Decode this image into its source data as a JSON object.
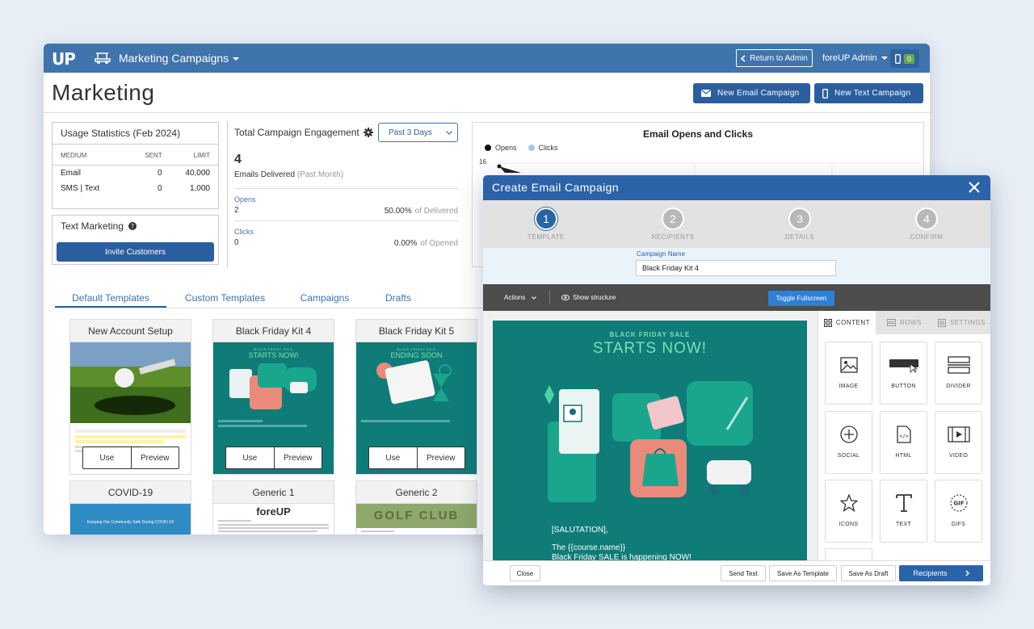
{
  "topbar": {
    "logo": "UP",
    "app_title": "Marketing Campaigns",
    "return_label": "Return to Admin",
    "admin_label": "foreUP Admin",
    "notification_count": "0"
  },
  "page": {
    "title": "Marketing",
    "new_email_label": "New Email Campaign",
    "new_text_label": "New Text Campaign"
  },
  "usage": {
    "title": "Usage Statistics (Feb 2024)",
    "headers": [
      "MEDIUM",
      "SENT",
      "LIMIT"
    ],
    "rows": [
      {
        "medium": "Email",
        "sent": "0",
        "limit": "40,000"
      },
      {
        "medium": "SMS | Text",
        "sent": "0",
        "limit": "1,000"
      }
    ]
  },
  "text_marketing": {
    "title": "Text Marketing",
    "invite_label": "Invite Customers"
  },
  "engagement": {
    "title": "Total Campaign Engagement",
    "period": "Past 3 Days",
    "delivered_count": "4",
    "delivered_label": "Emails Delivered",
    "delivered_note": "(Past Month)",
    "opens_label": "Opens",
    "opens_value": "2",
    "opens_pct": "50.00%",
    "opens_of": "of Delivered",
    "clicks_label": "Clicks",
    "clicks_value": "0",
    "clicks_pct": "0.00%",
    "clicks_of": "of Opened"
  },
  "chart_data": {
    "type": "line",
    "title": "Email Opens and Clicks",
    "series": [
      {
        "name": "Opens",
        "color": "#111111"
      },
      {
        "name": "Clicks",
        "color": "#a9c4e6"
      }
    ],
    "ytick_visible": "16"
  },
  "tabs": [
    {
      "label": "Default Templates",
      "active": true
    },
    {
      "label": "Custom Templates",
      "active": false
    },
    {
      "label": "Campaigns",
      "active": false
    },
    {
      "label": "Drafts",
      "active": false
    }
  ],
  "templates": [
    {
      "name": "New Account Setup"
    },
    {
      "name": "Black Friday Kit 4",
      "banner_small": "BLACK FRIDAY SALE",
      "banner_big": "STARTS NOW!"
    },
    {
      "name": "Black Friday Kit 5",
      "banner_small": "BLACK FRIDAY SALE",
      "banner_big": "ENDING SOON"
    },
    {
      "name": "COVID-19",
      "banner": "Keeping Our Community Safe During COVID-19"
    },
    {
      "name": "Generic 1",
      "logo": "foreUP"
    },
    {
      "name": "Generic 2",
      "banner": "GOLF CLUB"
    }
  ],
  "template_actions": {
    "use": "Use",
    "preview": "Preview"
  },
  "modal": {
    "title": "Create Email Campaign",
    "steps": [
      {
        "num": "1",
        "label": "TEMPLATE"
      },
      {
        "num": "2",
        "label": "RECIPIENTS"
      },
      {
        "num": "3",
        "label": "DETAILS"
      },
      {
        "num": "4",
        "label": "CONFIRM"
      }
    ],
    "campaign_name_label": "Campaign Name",
    "campaign_name_value": "Black Friday Kit 4",
    "toolbar": {
      "actions": "Actions",
      "show_structure": "Show structure",
      "toggle_fullscreen": "Toggle Fullscreen"
    },
    "canvas": {
      "small": "BLACK FRIDAY SALE",
      "big": "STARTS NOW!",
      "salutation": "[SALUTATION],",
      "course_line": "The {{course.name}}",
      "body_line": "Black Friday SALE is happening NOW!"
    },
    "side_tabs": [
      "CONTENT",
      "ROWS",
      "SETTINGS"
    ],
    "tiles": [
      "IMAGE",
      "BUTTON",
      "DIVIDER",
      "SOCIAL",
      "HTML",
      "VIDEO",
      "ICONS",
      "TEXT",
      "GIFS"
    ],
    "footer": {
      "close": "Close",
      "send_test": "Send Test",
      "save_template": "Save As Template",
      "save_draft": "Save As Draft",
      "recipients": "Recipients"
    }
  },
  "colors": {
    "primary": "#2b5e9e",
    "topbar": "#3f74ad",
    "teal": "#0f7c78",
    "accent_mint": "#7ee0b0"
  }
}
